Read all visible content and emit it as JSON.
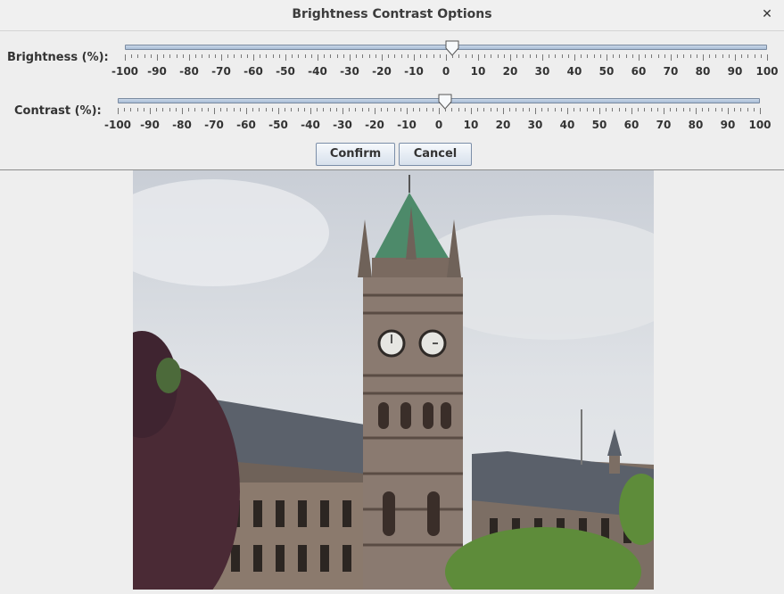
{
  "window": {
    "title": "Brightness Contrast Options",
    "close_glyph": "✕"
  },
  "brightness": {
    "label": "Brightness (%):",
    "min": -100,
    "max": 100,
    "value": 2,
    "tick_labels": [
      "-100",
      "-90",
      "-80",
      "-70",
      "-60",
      "-50",
      "-40",
      "-30",
      "-20",
      "-10",
      "0",
      "10",
      "20",
      "30",
      "40",
      "50",
      "60",
      "70",
      "80",
      "90",
      "100"
    ]
  },
  "contrast": {
    "label": "Contrast (%):",
    "min": -100,
    "max": 100,
    "value": 2,
    "tick_labels": [
      "-100",
      "-90",
      "-80",
      "-70",
      "-60",
      "-50",
      "-40",
      "-30",
      "-20",
      "-10",
      "0",
      "10",
      "20",
      "30",
      "40",
      "50",
      "60",
      "70",
      "80",
      "90",
      "100"
    ]
  },
  "buttons": {
    "confirm": "Confirm",
    "cancel": "Cancel"
  },
  "preview": {
    "subject": "clock tower building photo",
    "colors": {
      "sky": "#d9dde2",
      "stone": "#8a7a70",
      "roof": "#5e6670",
      "spire_green": "#4d8a6a",
      "tree_dark": "#4a2a35",
      "tree_green": "#5e8c3a"
    }
  }
}
